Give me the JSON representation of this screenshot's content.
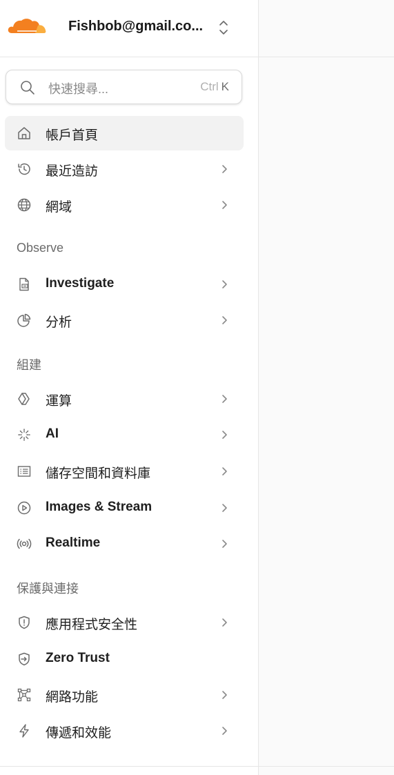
{
  "account": {
    "email": "Fishbob@gmail.co..."
  },
  "search": {
    "placeholder": "快速搜尋...",
    "shortcut_modifier": "Ctrl",
    "shortcut_key": "K"
  },
  "nav": {
    "top": [
      {
        "label": "帳戶首頁",
        "icon": "home-icon",
        "active": true,
        "has_submenu": false
      },
      {
        "label": "最近造訪",
        "icon": "history-icon",
        "active": false,
        "has_submenu": true
      },
      {
        "label": "網域",
        "icon": "globe-icon",
        "active": false,
        "has_submenu": true
      }
    ],
    "observe_title": "Observe",
    "observe": [
      {
        "label": "Investigate",
        "icon": "investigate-icon",
        "has_submenu": true
      },
      {
        "label": "分析",
        "icon": "pie-chart-icon",
        "has_submenu": true
      }
    ],
    "build_title": "組建",
    "build": [
      {
        "label": "運算",
        "icon": "compute-icon",
        "has_submenu": true
      },
      {
        "label": "AI",
        "icon": "sparkle-icon",
        "has_submenu": true
      },
      {
        "label": "儲存空間和資料庫",
        "icon": "storage-icon",
        "has_submenu": true
      },
      {
        "label": "Images & Stream",
        "icon": "play-circle-icon",
        "has_submenu": true
      },
      {
        "label": "Realtime",
        "icon": "broadcast-icon",
        "has_submenu": true
      }
    ],
    "protect_title": "保護與連接",
    "protect": [
      {
        "label": "應用程式安全性",
        "icon": "shield-icon",
        "has_submenu": true
      },
      {
        "label": "Zero Trust",
        "icon": "zero-trust-icon",
        "has_submenu": false
      },
      {
        "label": "網路功能",
        "icon": "network-icon",
        "has_submenu": true
      },
      {
        "label": "傳遞和效能",
        "icon": "lightning-icon",
        "has_submenu": true
      }
    ]
  },
  "colors": {
    "brand_orange": "#f38020",
    "brand_orange_light": "#faae40",
    "active_bg": "#f2f2f2",
    "icon_gray": "#6b6b6b"
  }
}
